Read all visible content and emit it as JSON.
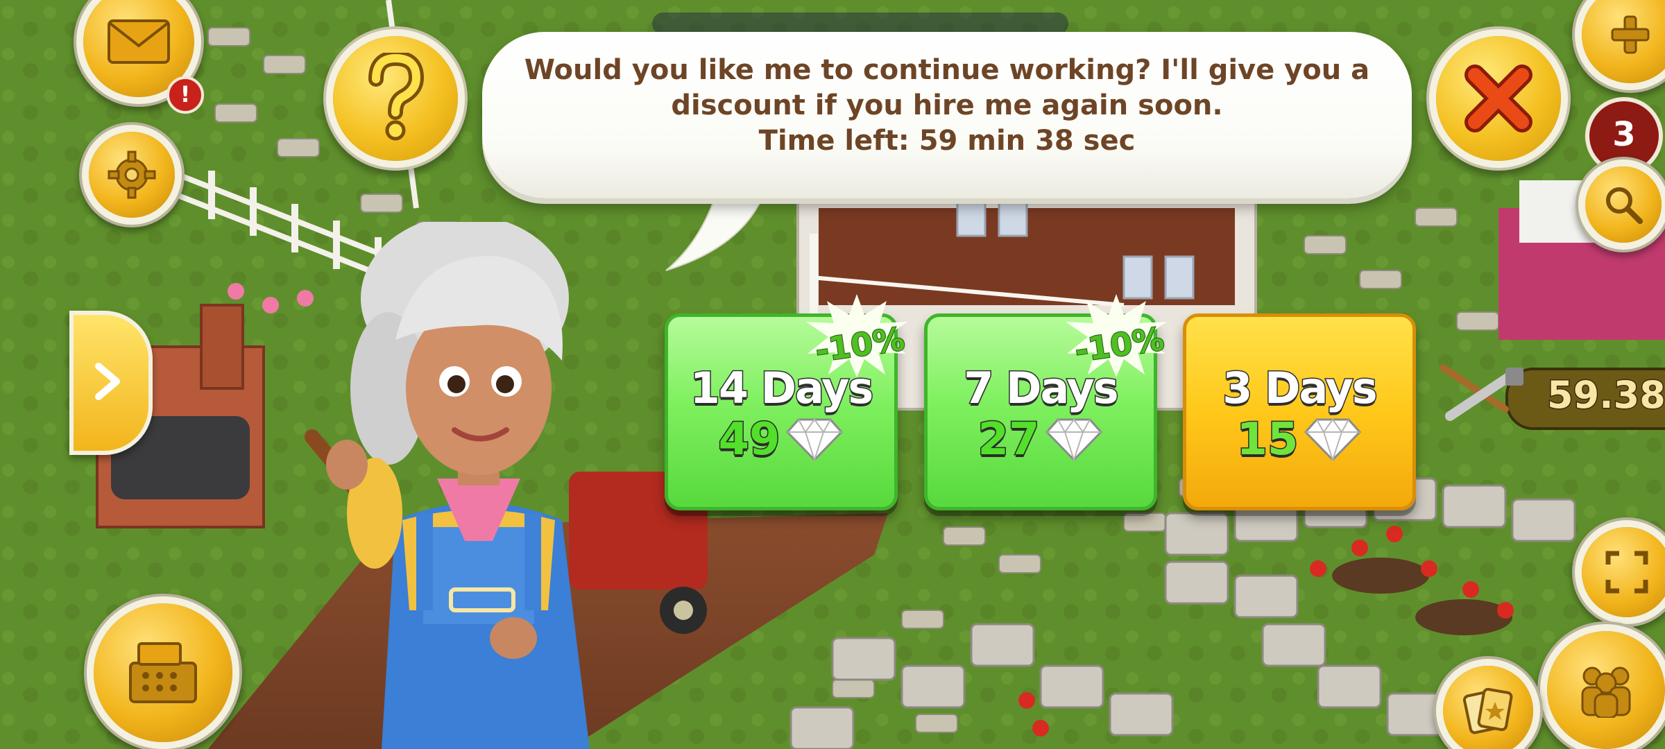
{
  "dialog": {
    "message": "Would you like me to continue working? I'll give you a discount if you hire me again soon.",
    "time_left": "Time left: 59 min 38 sec"
  },
  "options": [
    {
      "days": "14 Days",
      "price": "49",
      "discount": "-10%",
      "color": "#7ff05f"
    },
    {
      "days": "7 Days",
      "price": "27",
      "discount": "-10%",
      "color": "#7ff05f"
    },
    {
      "days": "3 Days",
      "price": "15",
      "discount": "",
      "color": "#ffc81a"
    }
  ],
  "hud": {
    "notification_badge": "!",
    "right_counter": "3",
    "worker_timer": "59.38"
  },
  "colors": {
    "grass": "#5f8d2a",
    "bubble_text": "#6d4526",
    "accent_gold": "#f2b51c",
    "close_red": "#e23a12"
  },
  "icons": [
    "help-icon",
    "close-icon",
    "mail-icon",
    "gear-icon",
    "arrow-right-icon",
    "cash-register-icon",
    "plus-icon",
    "magnifier-icon",
    "resize-icon",
    "friends-icon",
    "cards-icon",
    "diamond-icon",
    "saw-icon"
  ]
}
